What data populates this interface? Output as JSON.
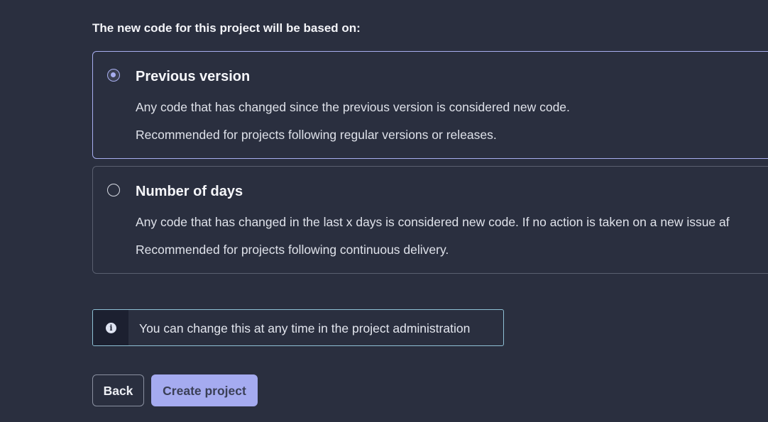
{
  "heading": "The new code for this project will be based on:",
  "options": [
    {
      "title": "Previous version",
      "selected": true,
      "description": "Any code that has changed since the previous version is considered new code.",
      "recommendation": "Recommended for projects following regular versions or releases."
    },
    {
      "title": "Number of days",
      "selected": false,
      "description": "Any code that has changed in the last x days is considered new code. If no action is taken on a new issue af",
      "recommendation": "Recommended for projects following continuous delivery."
    }
  ],
  "note": {
    "icon": "info-icon",
    "glyph": "i",
    "text": "You can change this at any time in the project administration"
  },
  "buttons": {
    "back_label": "Back",
    "create_label": "Create project"
  },
  "colors": {
    "background": "#2a2f3f",
    "accent": "#a5abf0",
    "info_border": "#8fc1d6"
  }
}
